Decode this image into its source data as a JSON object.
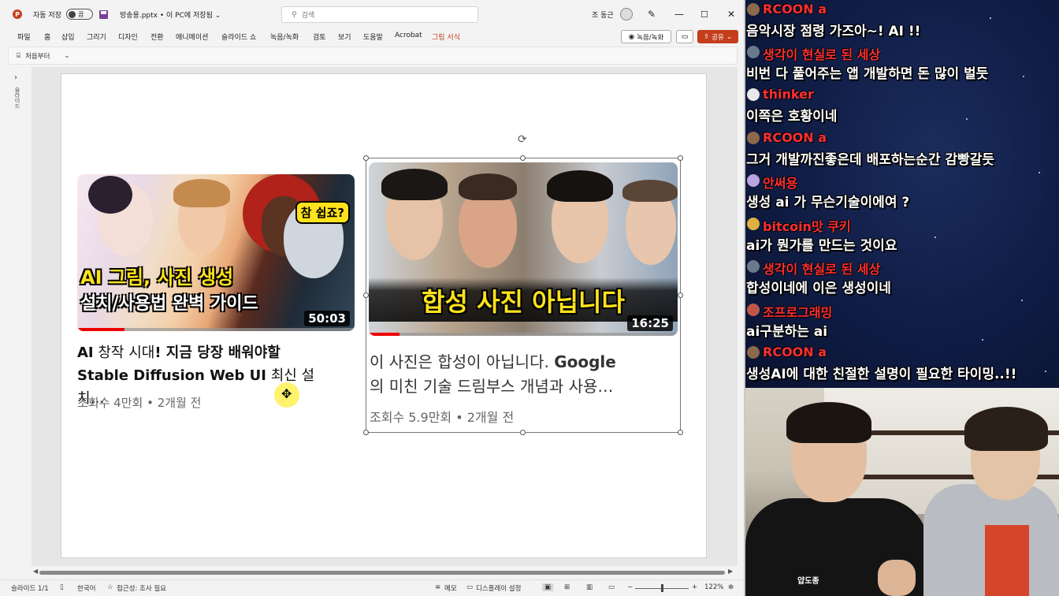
{
  "app": {
    "logo_letter": "P",
    "autosave_label": "자동 저장",
    "autosave_state": "끔",
    "filename": "방송용.pptx • 이 PC에 저장됨 ⌄",
    "search_placeholder": "검색",
    "user_name": "조 동근"
  },
  "menu": {
    "items": [
      "파일",
      "홈",
      "삽입",
      "그리기",
      "디자인",
      "전환",
      "애니메이션",
      "슬라이드 쇼",
      "녹음/녹화",
      "검토",
      "보기",
      "도움말",
      "Acrobat",
      "그림 서식"
    ],
    "active": "그림 서식",
    "record_label": "녹음/녹화",
    "share_label": "공유"
  },
  "quickbar": {
    "from_start_label": "처음부터",
    "more": "⌄"
  },
  "left_panel": {
    "label": "슬라이드"
  },
  "slide": {
    "video1": {
      "thumb_line1": "AI 그림, 사진 생성",
      "thumb_line2": "설치/사용법 완벽 가이드",
      "badge": "참 쉽죠?",
      "duration": "50:03",
      "progress": 0.17,
      "title_line1_a": "AI",
      "title_line1_b": " 창작 시대",
      "title_line1_c": "! 지금 당장 배워야할",
      "title_line2_a": "Stable Diffusion Web UI",
      "title_line2_b": " 최신 설치…",
      "meta": "조회수 4만회 • 2개월 전"
    },
    "video2": {
      "thumb_title": "합성 사진 아닙니다",
      "duration": "16:25",
      "progress": 0.1,
      "title_line1_a": "이 사진은 합성이 아닙니다. ",
      "title_line1_b": "Google",
      "title_line2": "의 미친 기술 드림부스 개념과 사용…",
      "meta": "조회수 5.9만회 • 2개월 전"
    }
  },
  "statusbar": {
    "slide_count": "슬라이드 1/1",
    "language": "한국어",
    "accessibility": "접근성: 조사 필요",
    "notes": "메모",
    "display_settings": "디스플레이 설정",
    "zoom": "122%"
  },
  "chat": [
    {
      "user": "RCOON a",
      "text": "음악시장 점령 가즈아~! AI !!",
      "avatar_color": "#8a6a4a"
    },
    {
      "user": "생각이 현실로 된 세상",
      "text": "비번 다 풀어주는 앱 개발하면 돈 많이 벌듯",
      "avatar_color": "#6a7a8a"
    },
    {
      "user": "thinker",
      "text": "이쪽은 호황이네",
      "avatar_color": "#e8e8e8"
    },
    {
      "user": "RCOON a",
      "text": "그거 개발까진좋은데 배포하는순간 감빵갈듯",
      "avatar_color": "#8a6a4a"
    },
    {
      "user": "안써용",
      "text": "생성 ai 가 무슨기술이에여 ?",
      "avatar_color": "#b9a3e0"
    },
    {
      "user": "bitcoin맛 쿠키",
      "text": "ai가 뭔가를 만드는 것이요",
      "avatar_color": "#e0b040"
    },
    {
      "user": "생각이 현실로 된 세상",
      "text": "합성이네에 이은 생성이네",
      "avatar_color": "#6a7a8a"
    },
    {
      "user": "조프로그래밍",
      "text": "ai구분하는 ai",
      "avatar_color": "#c0564a"
    },
    {
      "user": "RCOON a",
      "text": "생성AI에 대한 친절한 설명이 필요한 타이밍..!!",
      "avatar_color": "#8a6a4a"
    }
  ],
  "webcam": {
    "shirt_logo": "얍도종"
  },
  "colors": {
    "accent": "#c43e1c",
    "chat_user": "#ff3030",
    "chat_bg": "#0f1c44"
  }
}
